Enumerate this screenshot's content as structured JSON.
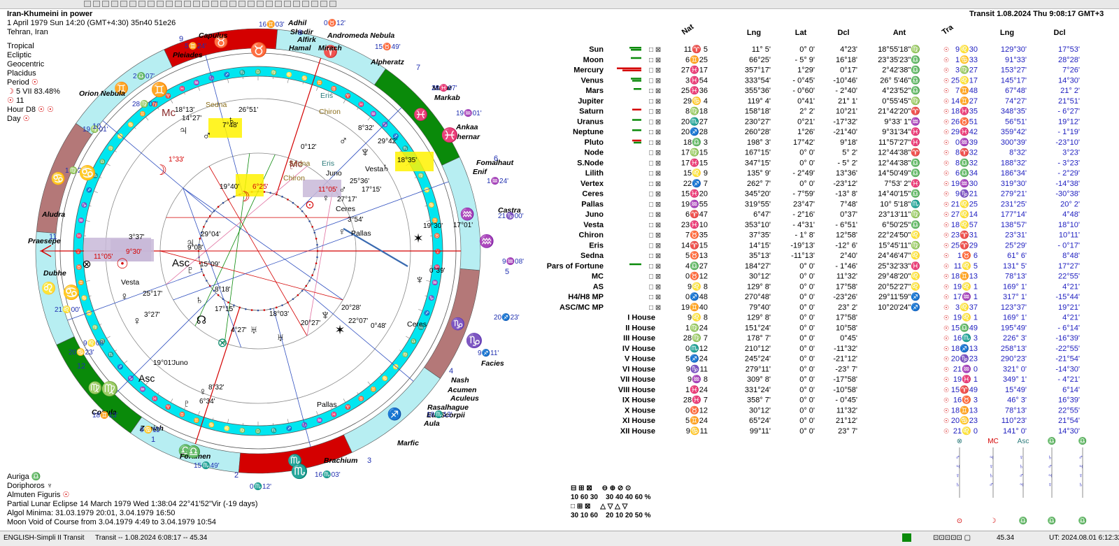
{
  "chart_info": {
    "title": "Iran-Khumeini in power",
    "date_line": "1 April 1979  Sun  14:20 (GMT+4:30) 35n40  51e26",
    "place": "Tehran, Iran",
    "zodiac": "Tropical",
    "coords": "Ecliptic",
    "center": "Geocentric",
    "houses": "Placidus",
    "period_label": "Period",
    "period_detail": "5 VII  83.48%",
    "period_num": "11",
    "hour_label": "Hour D8",
    "day_label": "Day"
  },
  "transit_header": "Transit  1.08.2024  Thu  9:08:17 GMT+3",
  "table_headers": {
    "nat": "Nat",
    "lng": "Lng",
    "lat": "Lat",
    "dcl": "Dcl",
    "ant": "Ant",
    "tra": "Tra",
    "tlng": "Lng",
    "tdcl": "Dcl"
  },
  "natal_rows": [
    {
      "name": "Sun",
      "pos": "11♈ 5",
      "lng": "11° 5'",
      "lat": "0° 0'",
      "dcl": "4°23'",
      "ant": "18°55'18\"♍"
    },
    {
      "name": "Moon",
      "pos": "6♊25",
      "lng": "66°25'",
      "lat": "- 5° 9'",
      "dcl": "16°18'",
      "ant": "23°35'23\"♎"
    },
    {
      "name": "Mercury",
      "pos": "27♓17",
      "lng": "357°17'",
      "lat": "1°29'",
      "dcl": "0°17'",
      "ant": "2°42'38\"♎"
    },
    {
      "name": "Venus",
      "pos": "3♓54",
      "lng": "333°54'",
      "lat": "- 0°45'",
      "dcl": "-10°46'",
      "ant": "26° 5'46\"♎"
    },
    {
      "name": "Mars",
      "pos": "25♓36",
      "lng": "355°36'",
      "lat": "- 0°60'",
      "dcl": "- 2°40'",
      "ant": "4°23'52\"♎"
    },
    {
      "name": "Jupiter",
      "pos": "29♋ 4",
      "lng": "119° 4'",
      "lat": "0°41'",
      "dcl": "21° 1'",
      "ant": "0°55'45\"♍"
    },
    {
      "name": "Saturn",
      "pos": "8♍18",
      "lng": "158°18'",
      "lat": "2° 2'",
      "dcl": "10°21'",
      "ant": "21°42'20\"♈"
    },
    {
      "name": "Uranus",
      "pos": "20♏27",
      "lng": "230°27'",
      "lat": "0°21'",
      "dcl": "-17°32'",
      "ant": "9°33' 1\"♒"
    },
    {
      "name": "Neptune",
      "pos": "20♐28",
      "lng": "260°28'",
      "lat": "1°26'",
      "dcl": "-21°40'",
      "ant": "9°31'34\"♓"
    },
    {
      "name": "Pluto",
      "pos": "18♎ 3",
      "lng": "198° 3'",
      "lat": "17°42'",
      "dcl": "9°18'",
      "ant": "11°57'27\"♓"
    },
    {
      "name": "Node",
      "pos": "17♍15",
      "lng": "167°15'",
      "lat": "0° 0'",
      "dcl": "5° 2'",
      "ant": "12°44'38\"♈"
    },
    {
      "name": "S.Node",
      "pos": "17♓15",
      "lng": "347°15'",
      "lat": "0° 0'",
      "dcl": "- 5° 2'",
      "ant": "12°44'38\"♎"
    },
    {
      "name": "Lilith",
      "pos": "15♌ 9",
      "lng": "135° 9'",
      "lat": "- 2°49'",
      "dcl": "13°36'",
      "ant": "14°50'49\"♎"
    },
    {
      "name": "Vertex",
      "pos": "22♐ 7",
      "lng": "262° 7'",
      "lat": "0° 0'",
      "dcl": "-23°12'",
      "ant": "7°53' 2\"♓"
    },
    {
      "name": "Ceres",
      "pos": "15♓20",
      "lng": "345°20'",
      "lat": "- 7°59'",
      "dcl": "-13° 8'",
      "ant": "14°40'15\"♎"
    },
    {
      "name": "Pallas",
      "pos": "19♒55",
      "lng": "319°55'",
      "lat": "23°47'",
      "dcl": "7°48'",
      "ant": "10° 5'18\"♏"
    },
    {
      "name": "Juno",
      "pos": "6♈47",
      "lng": "6°47'",
      "lat": "- 2°16'",
      "dcl": "0°37'",
      "ant": "23°13'11\"♍"
    },
    {
      "name": "Vesta",
      "pos": "23♓10",
      "lng": "353°10'",
      "lat": "- 4°31'",
      "dcl": "- 6°51'",
      "ant": "6°50'25\"♎"
    },
    {
      "name": "Chiron",
      "pos": "7♉35",
      "lng": "37°35'",
      "lat": "- 1° 8'",
      "dcl": "12°58'",
      "ant": "22°24'50\"♌"
    },
    {
      "name": "Eris",
      "pos": "14♈15",
      "lng": "14°15'",
      "lat": "-19°13'",
      "dcl": "-12° 6'",
      "ant": "15°45'11\"♍"
    },
    {
      "name": "Sedna",
      "pos": "5♉13",
      "lng": "35°13'",
      "lat": "-11°13'",
      "dcl": "2°40'",
      "ant": "24°46'47\"♌"
    },
    {
      "name": "Pars of Fortune",
      "pos": "4♎27",
      "lng": "184°27'",
      "lat": "0° 0'",
      "dcl": "- 1°46'",
      "ant": "25°32'33\"♓"
    },
    {
      "name": "MC",
      "pos": "0♉12",
      "lng": "30°12'",
      "lat": "0° 0'",
      "dcl": "11°32'",
      "ant": "29°48'20\"♌"
    },
    {
      "name": "AS",
      "pos": "9♌ 8",
      "lng": "129° 8'",
      "lat": "0° 0'",
      "dcl": "17°58'",
      "ant": "20°52'27\"♌"
    },
    {
      "name": "H4/H8 MP",
      "pos": "0♐48",
      "lng": "270°48'",
      "lat": "0° 0'",
      "dcl": "-23°26'",
      "ant": "29°11'59\"♐"
    },
    {
      "name": "ASC/MC MP",
      "pos": "19♊40",
      "lng": "79°40'",
      "lat": "0° 0'",
      "dcl": "23° 2'",
      "ant": "10°20'24\"♐"
    }
  ],
  "house_rows": [
    {
      "name": "I House",
      "pos": "9♌ 8",
      "lng": "129° 8'",
      "lat": "0° 0'",
      "dcl": "17°58'"
    },
    {
      "name": "II House",
      "pos": "1♍24",
      "lng": "151°24'",
      "lat": "0° 0'",
      "dcl": "10°58'"
    },
    {
      "name": "III House",
      "pos": "28♍ 7",
      "lng": "178° 7'",
      "lat": "0° 0'",
      "dcl": "0°45'"
    },
    {
      "name": "IV House",
      "pos": "0♏12",
      "lng": "210°12'",
      "lat": "0° 0'",
      "dcl": "-11°32'"
    },
    {
      "name": "V House",
      "pos": "5♐24",
      "lng": "245°24'",
      "lat": "0° 0'",
      "dcl": "-21°12'"
    },
    {
      "name": "VI House",
      "pos": "9♑11",
      "lng": "279°11'",
      "lat": "0° 0'",
      "dcl": "-23° 7'"
    },
    {
      "name": "VII House",
      "pos": "9♒ 8",
      "lng": "309° 8'",
      "lat": "0° 0'",
      "dcl": "-17°58'"
    },
    {
      "name": "VIII House",
      "pos": "1♓24",
      "lng": "331°24'",
      "lat": "0° 0'",
      "dcl": "-10°58'"
    },
    {
      "name": "IX House",
      "pos": "28♓ 7",
      "lng": "358° 7'",
      "lat": "0° 0'",
      "dcl": "- 0°45'"
    },
    {
      "name": "X House",
      "pos": "0♉12",
      "lng": "30°12'",
      "lat": "0° 0'",
      "dcl": "11°32'"
    },
    {
      "name": "XI House",
      "pos": "5♊24",
      "lng": "65°24'",
      "lat": "0° 0'",
      "dcl": "21°12'"
    },
    {
      "name": "XII House",
      "pos": "9♋11",
      "lng": "99°11'",
      "lat": "0° 0'",
      "dcl": "23° 7'"
    }
  ],
  "transit_rows": [
    {
      "pos": "9♌30",
      "lng": "129°30'",
      "dcl": "17°53'"
    },
    {
      "pos": "1♋33",
      "lng": "91°33'",
      "dcl": "28°28'"
    },
    {
      "pos": "3♍27",
      "lng": "153°27'",
      "dcl": "7°26'"
    },
    {
      "pos": "25♌17",
      "lng": "145°17'",
      "dcl": "14°30'"
    },
    {
      "pos": "7♊48",
      "lng": "67°48'",
      "dcl": "21° 2'"
    },
    {
      "pos": "14♊27",
      "lng": "74°27'",
      "dcl": "21°51'"
    },
    {
      "pos": "18♓35",
      "lng": "348°35'",
      "dcl": "- 6°27'"
    },
    {
      "pos": "26♉51",
      "lng": "56°51'",
      "dcl": "19°12'"
    },
    {
      "pos": "29♓42",
      "lng": "359°42'",
      "dcl": "- 1°19'"
    },
    {
      "pos": "0♒39",
      "lng": "300°39'",
      "dcl": "-23°10'"
    },
    {
      "pos": "8♈32",
      "lng": "8°32'",
      "dcl": "3°23'"
    },
    {
      "pos": "8♎32",
      "lng": "188°32'",
      "dcl": "- 3°23'"
    },
    {
      "pos": "6♎34",
      "lng": "186°34'",
      "dcl": "- 2°29'"
    },
    {
      "pos": "19♒30",
      "lng": "319°30'",
      "dcl": "-14°38'"
    },
    {
      "pos": "9♑21",
      "lng": "279°21'",
      "dcl": "-30°38'"
    },
    {
      "pos": "21♌25",
      "lng": "231°25'",
      "dcl": "20° 2'"
    },
    {
      "pos": "27♌14",
      "lng": "177°14'",
      "dcl": "4°48'"
    },
    {
      "pos": "18♌57",
      "lng": "138°57'",
      "dcl": "18°10'"
    },
    {
      "pos": "23♈31",
      "lng": "23°31'",
      "dcl": "10°11'"
    },
    {
      "pos": "25♈29",
      "lng": "25°29'",
      "dcl": "- 0°17'"
    },
    {
      "pos": "1♉ 6",
      "lng": "61° 6'",
      "dcl": "8°48'"
    },
    {
      "pos": "11♌ 5",
      "lng": "131° 5'",
      "dcl": "17°27'"
    },
    {
      "pos": "18♊13",
      "lng": "78°13'",
      "dcl": "22°55'"
    },
    {
      "pos": "19♌ 1",
      "lng": "169° 1'",
      "dcl": "4°21'"
    },
    {
      "pos": "17♒ 1",
      "lng": "317° 1'",
      "dcl": "-15°44'"
    },
    {
      "pos": "3♌37",
      "lng": "123°37'",
      "dcl": "19°21'"
    },
    {
      "pos": "19♌ 1",
      "lng": "169° 1'",
      "dcl": "4°21'"
    },
    {
      "pos": "15♎49",
      "lng": "195°49'",
      "dcl": "- 6°14'"
    },
    {
      "pos": "16♏ 3",
      "lng": "226° 3'",
      "dcl": "-16°39'"
    },
    {
      "pos": "18♐13",
      "lng": "258°13'",
      "dcl": "-22°55'"
    },
    {
      "pos": "20♑23",
      "lng": "290°23'",
      "dcl": "-21°54'"
    },
    {
      "pos": "21♒ 0",
      "lng": "321° 0'",
      "dcl": "-14°30'"
    },
    {
      "pos": "19♓ 1",
      "lng": "349° 1'",
      "dcl": "- 4°21'"
    },
    {
      "pos": "15♈49",
      "lng": "15°49'",
      "dcl": "6°14'"
    },
    {
      "pos": "16♉ 3",
      "lng": "46° 3'",
      "dcl": "16°39'"
    },
    {
      "pos": "18♊13",
      "lng": "78°13'",
      "dcl": "22°55'"
    },
    {
      "pos": "20♋23",
      "lng": "110°23'",
      "dcl": "21°54'"
    },
    {
      "pos": "21♌ 0",
      "lng": "141° 0'",
      "dcl": "14°30'"
    }
  ],
  "wheel_labels": {
    "stars": [
      "Capulus",
      "Adhil",
      "Shedir",
      "Alfirk",
      "Hamal",
      "Mirach",
      "Andromeda Nebula",
      "Alpheratz",
      "Matar",
      "Markab",
      "Ankaa",
      "Achernar",
      "Fomalhaut",
      "Enif",
      "Castra",
      "Facies",
      "Nash",
      "Acumen",
      "Aculeus",
      "Rasalhague",
      "Eta Scorpii",
      "Aula",
      "Marfic",
      "Brachium",
      "Foramen",
      "Zaniah",
      "Copula",
      "Dubhe",
      "Praesepe",
      "Aludra",
      "Orion Nebula",
      "Pleiades"
    ],
    "cusps": [
      "16♊03'",
      "0♉12'",
      "15♉49'",
      "28♓07'",
      "19♒01'",
      "1♒24'",
      "21♑00'",
      "9♒08'",
      "20♐23'",
      "9♐11'",
      "18♏13'",
      "15♏49'",
      "0♏12'",
      "16♏03'",
      "2♎07'",
      "28♍07'",
      "19♍01'",
      "1♍24'",
      "21♌00'",
      "9♌08'",
      "20♋23'",
      "9♋11'",
      "18♊13'",
      "5♊24'"
    ],
    "house_numbers": [
      "1",
      "2",
      "3",
      "4",
      "5",
      "6",
      "7",
      "8",
      "9",
      "10",
      "11",
      "12"
    ],
    "inner": [
      "18°13'",
      "14°27'",
      "26°51'",
      "7°48'",
      "Sedna",
      "Chiron",
      "Eris",
      "1°33'",
      "0°12'",
      "Sedna",
      "Eris",
      "Chiron",
      "Juno",
      "8°32'",
      "29°42'",
      "18°35'",
      "Vesta",
      "6°25'",
      "19°40'",
      "11°05'",
      "25°36'",
      "17°15'",
      "27°17'",
      "Ceres",
      "3°54'",
      "Pallas",
      "19°30'",
      "17°01'",
      "3°37'",
      "29°04'",
      "9°08'",
      "15°09'",
      "11°05'",
      "9°30'",
      "0°39'",
      "Vesta",
      "25°17'",
      "3°27'",
      "8°18'",
      "17°15'",
      "18°03'",
      "20°27'",
      "20°28'",
      "22°07'",
      "0°48'",
      "Ceres",
      "4°27'",
      "19°01'",
      "Juno",
      "8°32'",
      "6°34'",
      "Pallas"
    ]
  },
  "bottom_info": [
    "Auriga",
    "Doriphoros",
    "Almuten Figuris",
    "Partial Lunar Eclipse 14 March 1979 Wed  1:38:04 22°41'52\"Vir (-19 days)",
    "Algol Minima: 31.03.1979 20:01,  3.04.1979 16:50",
    "Moon Void of Course from 3.04.1979  4:49 to 3.04.1979 10:54"
  ],
  "element_stats": {
    "row1": [
      "10",
      "60",
      "30"
    ],
    "row2": [
      "30",
      "10",
      "60"
    ],
    "row3": [
      "30",
      "40",
      "40",
      "60 %"
    ],
    "row4": [
      "20",
      "10",
      "20",
      "50 %"
    ]
  },
  "status": {
    "left": "ENGLISH-Simpli II Transit",
    "mid": "Transit -- 1.08.2024  6:08:17 -- 45.34",
    "right_num": "45.34",
    "ut": "UT: 2024.08.01  6:12:32"
  },
  "colors": {
    "red": "#d40000",
    "green": "#0a8a0a",
    "cyan": "#00e6f0",
    "lightcyan": "#b7eef2",
    "brown": "#b47878",
    "blue": "#2020c0",
    "yellow": "#fff200",
    "lavender": "#c8b8d8"
  }
}
